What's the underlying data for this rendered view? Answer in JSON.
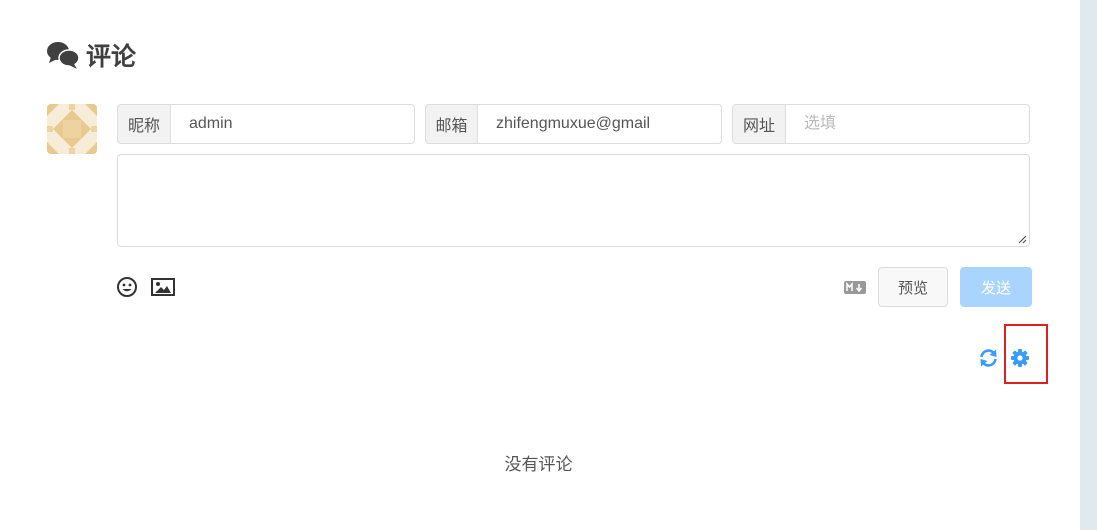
{
  "header": {
    "title": "评论",
    "icon": "comments-icon"
  },
  "form": {
    "avatar": "identicon-avatar",
    "nick": {
      "label": "昵称",
      "value": "admin",
      "placeholder": ""
    },
    "mail": {
      "label": "邮箱",
      "value": "zhifengmuxue@gmail",
      "placeholder": ""
    },
    "link": {
      "label": "网址",
      "value": "",
      "placeholder": "选填"
    },
    "comment": {
      "value": "",
      "placeholder": ""
    }
  },
  "toolbar": {
    "emoji_icon": "smile-icon",
    "image_icon": "image-icon",
    "markdown_icon": "markdown-icon",
    "preview_label": "预览",
    "send_label": "发送"
  },
  "actions": {
    "refresh_icon": "refresh-icon",
    "settings_icon": "gear-icon"
  },
  "colors": {
    "accent": "#3b9cf7",
    "send_disabled": "#a8d4fd",
    "highlight": "#e02020"
  },
  "status": {
    "empty_text": "没有评论"
  }
}
